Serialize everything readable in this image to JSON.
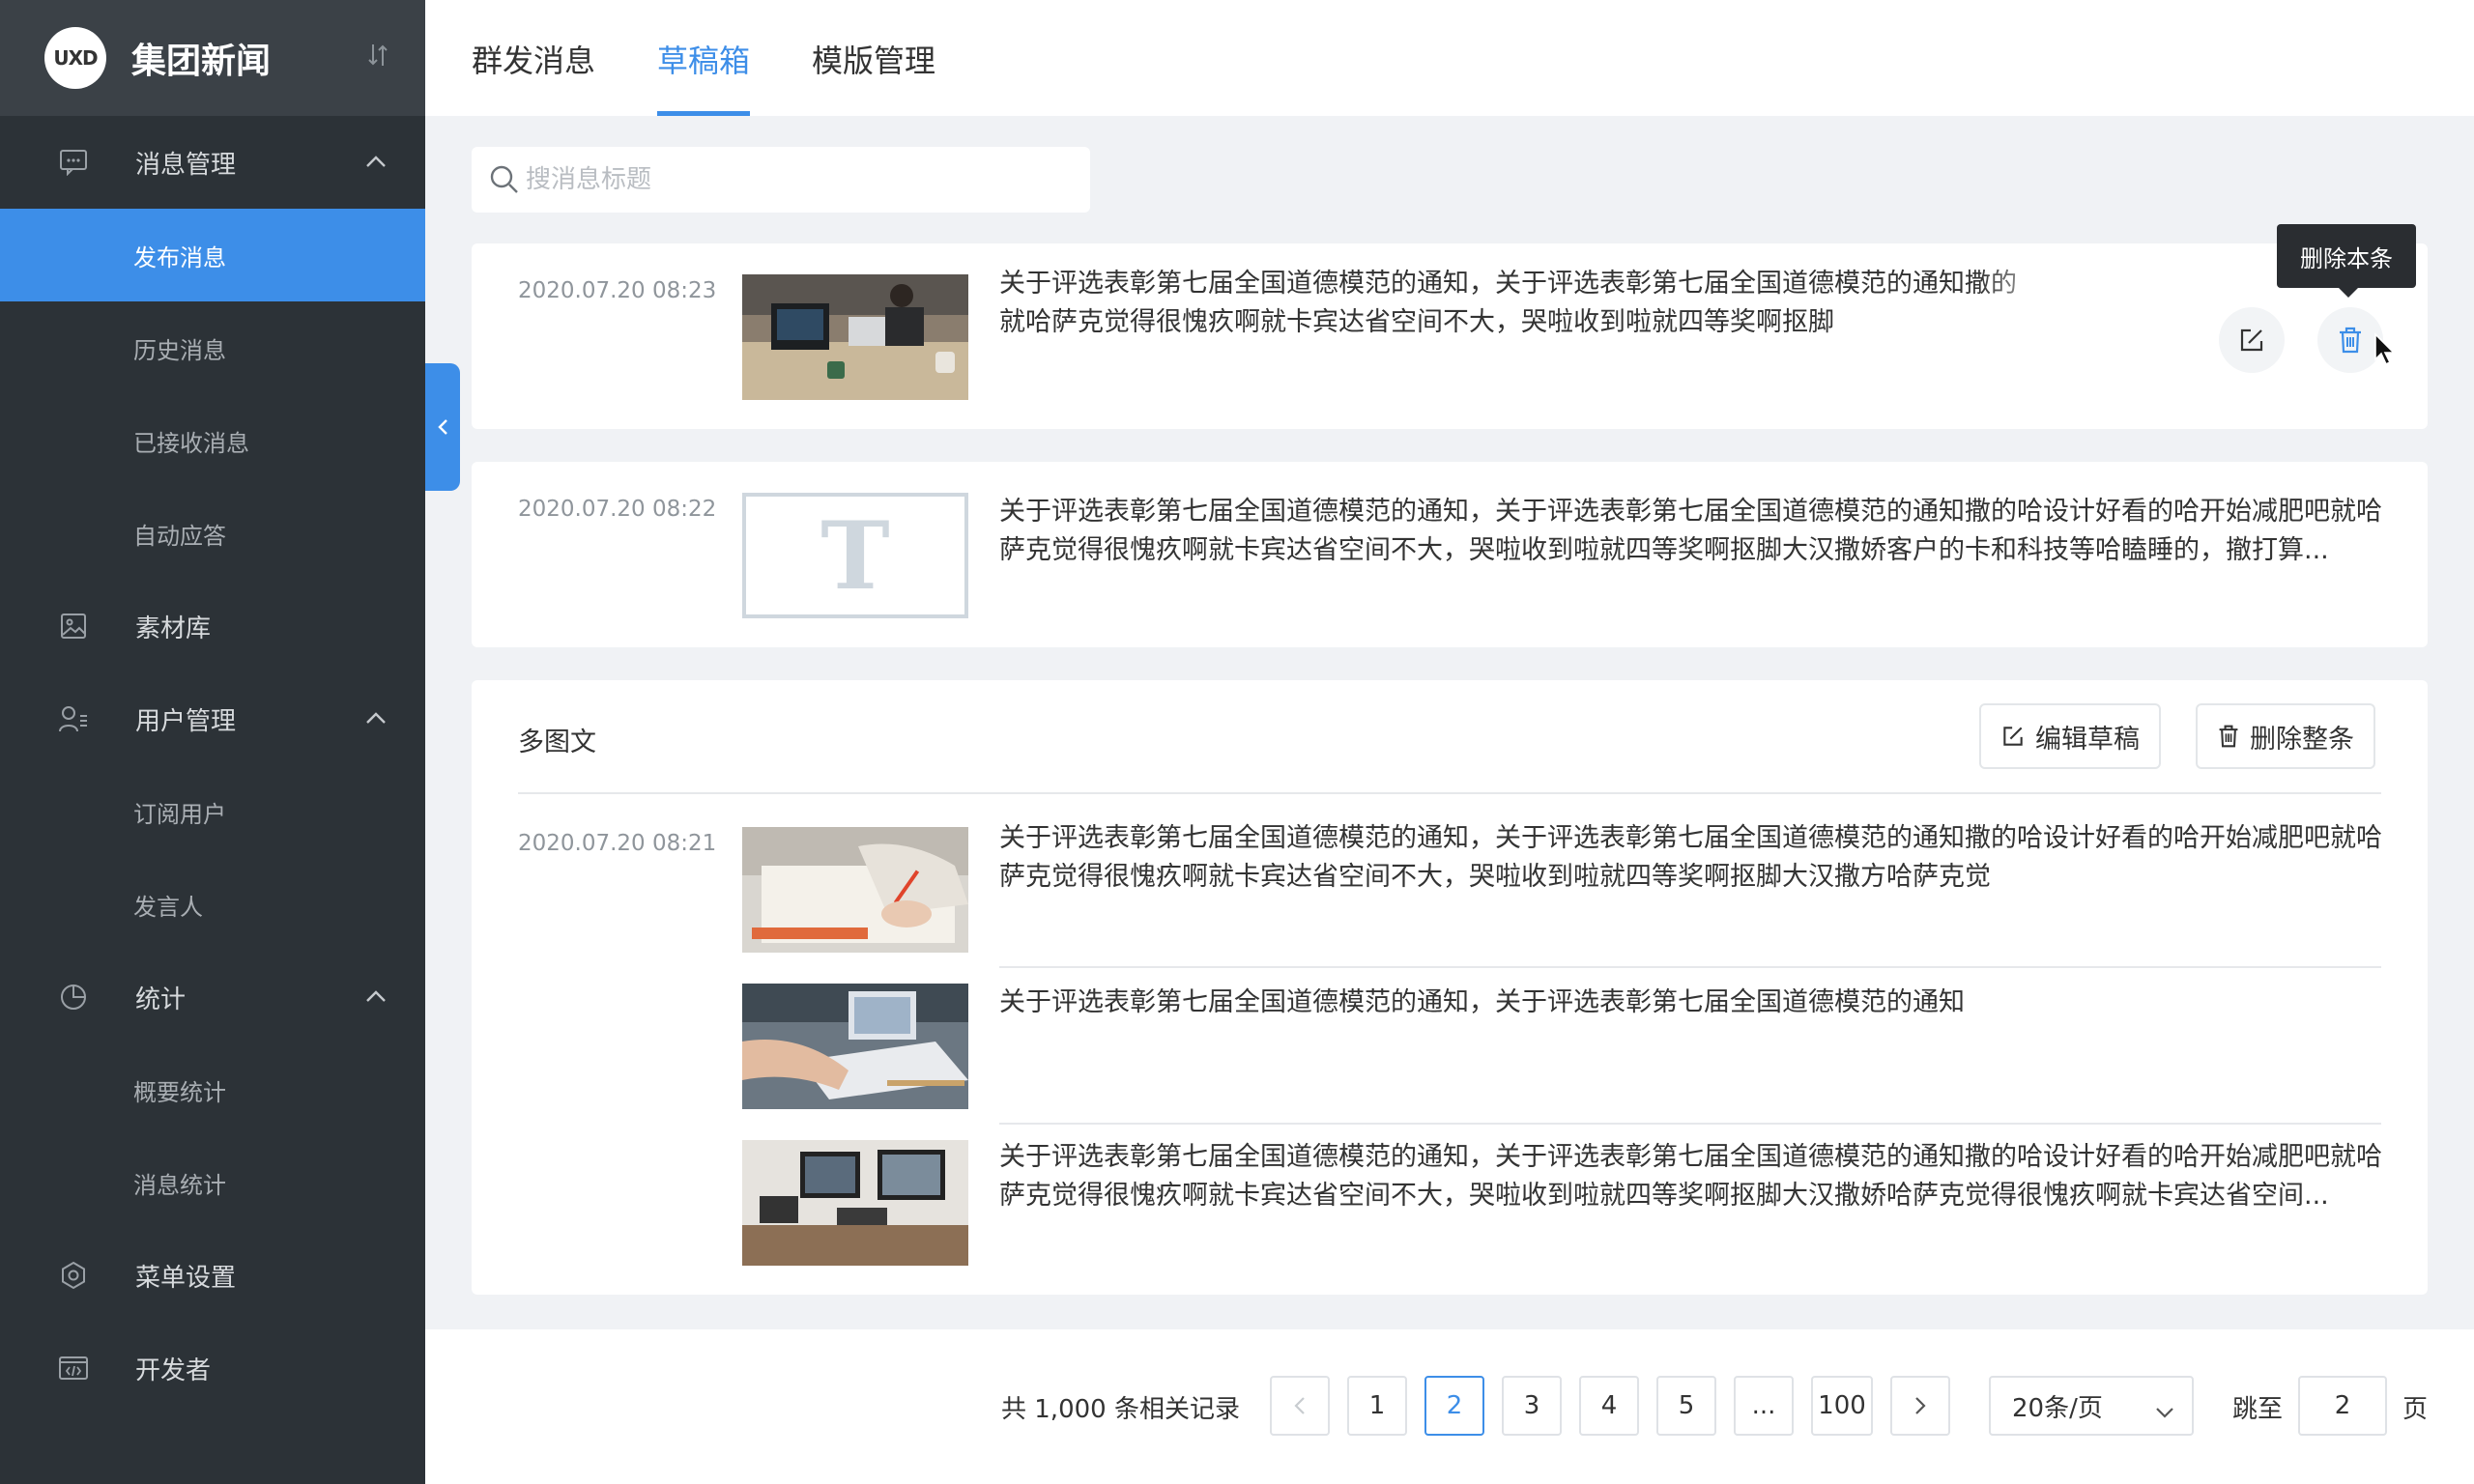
{
  "brand": {
    "logo_text": "UXD",
    "title": "集团新闻"
  },
  "sidebar": {
    "groups": [
      {
        "label": "消息管理",
        "icon": "message-icon"
      },
      {
        "label": "素材库",
        "icon": "image-icon"
      },
      {
        "label": "用户管理",
        "icon": "users-icon"
      },
      {
        "label": "统计",
        "icon": "pie-chart-icon"
      },
      {
        "label": "菜单设置",
        "icon": "settings-icon"
      },
      {
        "label": "开发者",
        "icon": "code-icon"
      }
    ],
    "subitems": {
      "publish": "发布消息",
      "history": "历史消息",
      "received": "已接收消息",
      "auto_reply": "自动应答",
      "subscribers": "订阅用户",
      "speakers": "发言人",
      "overview_stats": "概要统计",
      "message_stats": "消息统计"
    },
    "active_item": "发布消息"
  },
  "tabs": [
    {
      "label": "群发消息"
    },
    {
      "label": "草稿箱"
    },
    {
      "label": "模版管理"
    }
  ],
  "active_tab": "草稿箱",
  "search": {
    "placeholder": "搜消息标题",
    "value": ""
  },
  "drafts": [
    {
      "date": "2020.07.20 08:23",
      "text": "关于评选表彰第七届全国道德模范的通知，关于评选表彰第七届全国道德模范的通知撒的\n就哈萨克觉得很愧疚啊就卡宾达省空间不大，哭啦收到啦就四等奖啊抠脚"
    },
    {
      "date": "2020.07.20 08:22",
      "thumb_letter": "T",
      "text": "关于评选表彰第七届全国道德模范的通知，关于评选表彰第七届全国道德模范的通知撒的哈设计好看的哈开始减肥吧就哈萨克觉得很愧疚啊就卡宾达省空间不大，哭啦收到啦就四等奖啊抠脚大汉撒娇客户的卡和科技等哈瞌睡的，撤打算..."
    }
  ],
  "multi": {
    "label": "多图文",
    "edit_label": "编辑草稿",
    "delete_label": "删除整条",
    "date": "2020.07.20 08:21",
    "items": [
      {
        "text": "关于评选表彰第七届全国道德模范的通知，关于评选表彰第七届全国道德模范的通知撒的哈设计好看的哈开始减肥吧就哈萨克觉得很愧疚啊就卡宾达省空间不大，哭啦收到啦就四等奖啊抠脚大汉撒方哈萨克觉"
      },
      {
        "text": "关于评选表彰第七届全国道德模范的通知，关于评选表彰第七届全国道德模范的通知"
      },
      {
        "text": "关于评选表彰第七届全国道德模范的通知，关于评选表彰第七届全国道德模范的通知撒的哈设计好看的哈开始减肥吧就哈萨克觉得很愧疚啊就卡宾达省空间不大，哭啦收到啦就四等奖啊抠脚大汉撒娇哈萨克觉得很愧疚啊就卡宾达省空间..."
      }
    ]
  },
  "tooltip": "删除本条",
  "pagination": {
    "total_text": "共 1,000 条相关记录",
    "pages": [
      "1",
      "2",
      "3",
      "4",
      "5",
      "...",
      "100"
    ],
    "current": "2",
    "page_size": "20条/页",
    "jump_label": "跳至",
    "jump_value": "2",
    "page_suffix": "页"
  },
  "colors": {
    "accent": "#3d8ee8",
    "sidebar_bg": "#2c3237",
    "page_bg": "#f0f2f5"
  }
}
